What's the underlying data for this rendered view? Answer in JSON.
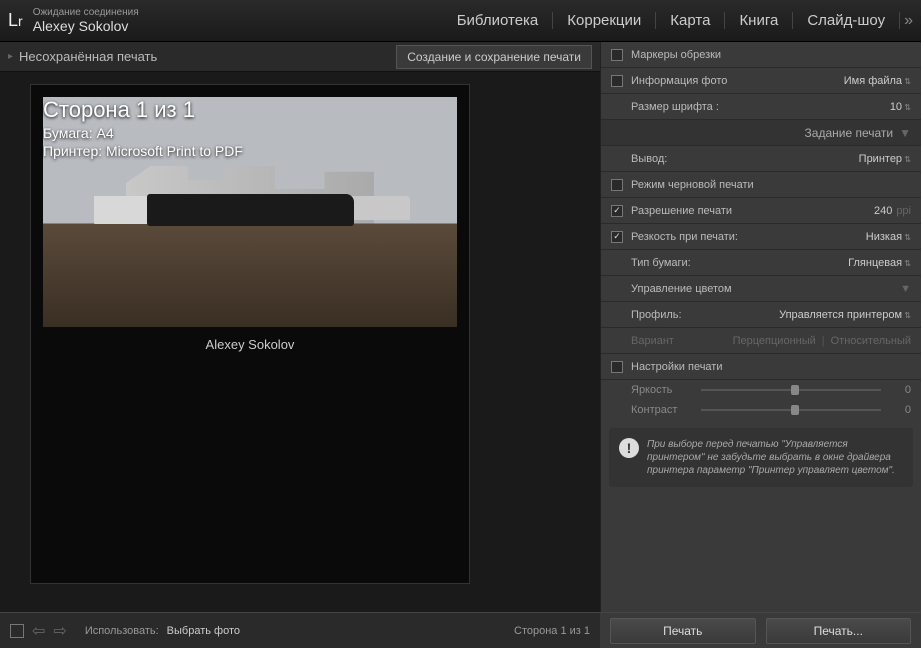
{
  "header": {
    "status": "Ожидание соединения",
    "user": "Alexey Sokolov",
    "nav": [
      "Библиотека",
      "Коррекции",
      "Карта",
      "Книга",
      "Слайд-шоу"
    ]
  },
  "subbar": {
    "title": "Несохранённая печать",
    "button": "Создание и сохранение печати"
  },
  "preview": {
    "page_title": "Сторона 1 из 1",
    "paper": "Бумага:  A4",
    "printer": "Принтер:  Microsoft Print to PDF",
    "caption": "Alexey Sokolov"
  },
  "panel": {
    "crop_markers": "Маркеры обрезки",
    "photo_info": "Информация фото",
    "photo_info_val": "Имя файла",
    "font_size_lbl": "Размер шрифта :",
    "font_size_val": "10",
    "job_header": "Задание печати",
    "output_lbl": "Вывод:",
    "output_val": "Принтер",
    "draft": "Режим черновой печати",
    "resolution_lbl": "Разрешение печати",
    "resolution_val": "240",
    "resolution_unit": "ppi",
    "sharpen_lbl": "Резкость при печати:",
    "sharpen_val": "Низкая",
    "paper_type_lbl": "Тип бумаги:",
    "paper_type_val": "Глянцевая",
    "color_mgmt": "Управление цветом",
    "profile_lbl": "Профиль:",
    "profile_val": "Управляется принтером",
    "variant_lbl": "Вариант",
    "variant_opt1": "Перцепционный",
    "variant_opt2": "Относительный",
    "print_settings": "Настройки печати",
    "brightness": "Яркость",
    "contrast": "Контраст",
    "slider_val": "0",
    "info": "При выборе перед печатью \"Управляется принтером\" не забудьте выбрать в окне драйвера принтера параметр \"Принтер управляет цветом\"."
  },
  "footer": {
    "use": "Использовать:",
    "select": "Выбрать фото",
    "page": "Сторона 1 из 1",
    "print": "Печать",
    "print_dlg": "Печать..."
  }
}
